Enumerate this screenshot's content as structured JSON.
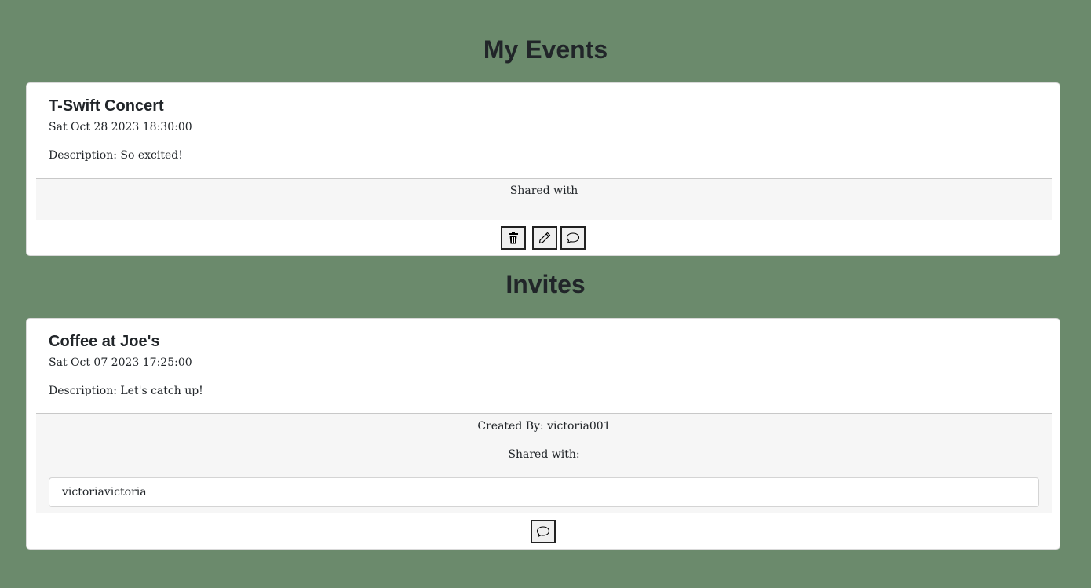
{
  "my_events": {
    "title": "My Events",
    "event": {
      "name": "T-Swift Concert",
      "date": "Sat Oct 28 2023 18:30:00",
      "description": "Description: So excited!",
      "shared_label": "Shared with",
      "actions": {
        "delete_icon": "trash-icon",
        "edit_icon": "pencil-icon",
        "comment_icon": "chat-bubble-icon"
      }
    }
  },
  "invites": {
    "title": "Invites",
    "invite": {
      "name": "Coffee at Joe's",
      "date": "Sat Oct 07 2023 17:25:00",
      "description": "Description: Let's catch up!",
      "created_by": "Created By: victoria001",
      "shared_label": "Shared with:",
      "shared_users": [
        "victoriavictoria"
      ],
      "actions": {
        "comment_icon": "chat-bubble-icon"
      }
    }
  }
}
